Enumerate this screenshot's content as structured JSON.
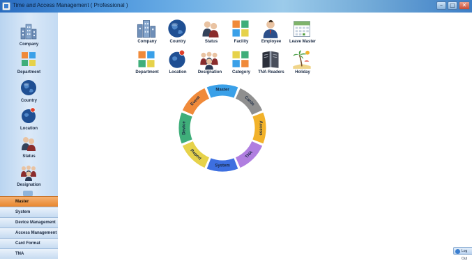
{
  "window": {
    "title": "Time and Access Management ( Professional )",
    "buttons": [
      "–",
      "□",
      "✕"
    ]
  },
  "sidebar": {
    "icon_items": [
      {
        "label": "Company",
        "icon": "company-building-icon"
      },
      {
        "label": "Department",
        "icon": "department-blocks-icon"
      },
      {
        "label": "Country",
        "icon": "country-globe-icon"
      },
      {
        "label": "Location",
        "icon": "location-globe-pin-icon"
      },
      {
        "label": "Status",
        "icon": "status-people-icon"
      },
      {
        "label": "Designation",
        "icon": "designation-group-icon"
      }
    ],
    "nav_buttons": [
      {
        "label": "Master",
        "active": true
      },
      {
        "label": "System",
        "active": false
      },
      {
        "label": "Device Management",
        "active": false
      },
      {
        "label": "Access Management",
        "active": false
      },
      {
        "label": "Card Format",
        "active": false
      },
      {
        "label": "TNA",
        "active": false
      }
    ]
  },
  "toolbar": {
    "row1": [
      {
        "label": "Company",
        "icon": "company-building-icon"
      },
      {
        "label": "Country",
        "icon": "country-globe-icon"
      },
      {
        "label": "Status",
        "icon": "status-people-icon"
      },
      {
        "label": "Facility",
        "icon": "facility-blocks-icon"
      },
      {
        "label": "Employee",
        "icon": "employee-person-icon"
      },
      {
        "label": "Leave Master",
        "icon": "leave-calendar-icon"
      }
    ],
    "row2": [
      {
        "label": "Department",
        "icon": "department-blocks-icon"
      },
      {
        "label": "Location",
        "icon": "location-globe-pin-icon"
      },
      {
        "label": "Designation",
        "icon": "designation-group-icon"
      },
      {
        "label": "Category",
        "icon": "category-blocks-icon"
      },
      {
        "label": "TNA Readers",
        "icon": "tna-readers-book-icon"
      },
      {
        "label": "Holiday",
        "icon": "holiday-beach-icon"
      }
    ]
  },
  "wheel": {
    "segments": [
      {
        "label": "Master",
        "color": "#3aa0e8"
      },
      {
        "label": "Cards",
        "color": "#8f8f8f"
      },
      {
        "label": "Access",
        "color": "#f2b22a"
      },
      {
        "label": "TNA",
        "color": "#b07ee0"
      },
      {
        "label": "System",
        "color": "#3d6fe0"
      },
      {
        "label": "Report",
        "color": "#e6d24a"
      },
      {
        "label": "Device",
        "color": "#3fae7a"
      },
      {
        "label": "Event",
        "color": "#f08a3a"
      }
    ]
  },
  "statusbar": {
    "logout_label": "Log Out"
  }
}
